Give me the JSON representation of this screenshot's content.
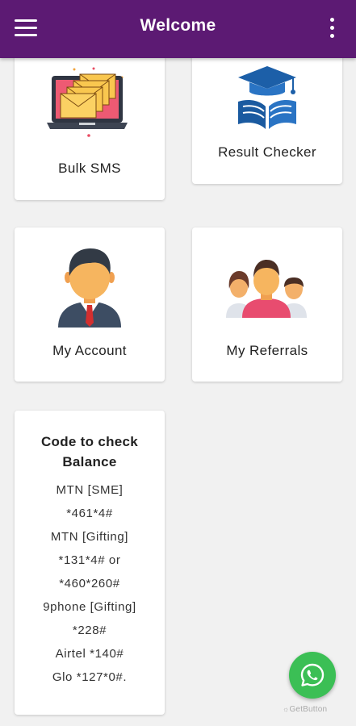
{
  "appbar": {
    "title": "Welcome",
    "menu_icon": "hamburger-menu-icon",
    "more_icon": "more-vertical-icon",
    "color": "#5c1a73"
  },
  "cards": {
    "bulk_sms": {
      "label": "Bulk SMS",
      "icon": "envelopes-laptop-icon"
    },
    "result_checker": {
      "label": "Result Checker",
      "icon": "graduation-book-icon"
    },
    "my_account": {
      "label": "My Account",
      "icon": "businessman-icon"
    },
    "my_referrals": {
      "label": "My Referrals",
      "icon": "group-people-icon"
    }
  },
  "balance": {
    "title": "Code to check Balance",
    "codes": [
      "MTN [SME]",
      "*461*4#",
      "MTN [Gifting]",
      "*131*4# or",
      "*460*260#",
      "9phone [Gifting]",
      "*228#",
      "Airtel *140#",
      "Glo *127*0#."
    ]
  },
  "fab": {
    "icon": "whatsapp-icon",
    "color": "#3bbf55"
  },
  "watermark": "GetButton"
}
